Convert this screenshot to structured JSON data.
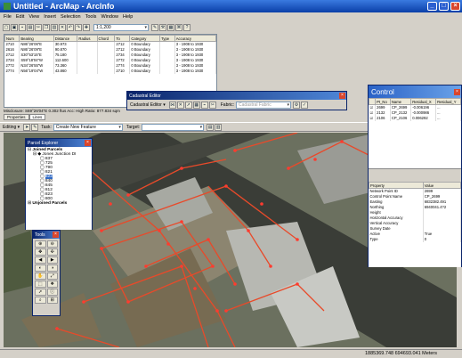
{
  "app": {
    "title": "Untitled - ArcMap - ArcInfo",
    "min": "_",
    "max": "□",
    "close": "×"
  },
  "menu": [
    "File",
    "Edit",
    "View",
    "Insert",
    "Selection",
    "Tools",
    "Window",
    "Help"
  ],
  "toolbar": {
    "scale": "1:1,200"
  },
  "table": {
    "headers": [
      "Num",
      "Bearing",
      "Distance",
      "Radius",
      "Chord",
      "To",
      "Category",
      "Type",
      "Accuracy"
    ],
    "rows": [
      [
        "2710",
        "N86°26'06\"E",
        "30.973",
        "",
        "",
        "2712",
        "0 Boundary",
        "",
        "3 - 1908 to 1930"
      ],
      [
        "2616",
        "N86°26'09\"E",
        "90.870",
        "",
        "",
        "2712",
        "0 Boundary",
        "",
        "3 - 1908 to 1930"
      ],
      [
        "2712",
        "S30°53'15\"E",
        "75.180",
        "",
        "",
        "2734",
        "0 Boundary",
        "",
        "3 - 1908 to 1930"
      ],
      [
        "2734",
        "S59°18'04\"W",
        "112.600",
        "",
        "",
        "2772",
        "0 Boundary",
        "",
        "3 - 1908 to 1930"
      ],
      [
        "2772",
        "N34°26'55\"W",
        "73.360",
        "",
        "",
        "2774",
        "0 Boundary",
        "",
        "3 - 1908 to 1930"
      ],
      [
        "2774",
        "N56°19'04\"W",
        "43.860",
        "",
        "",
        "2710",
        "0 Boundary",
        "",
        "3 - 1908 to 1930"
      ]
    ],
    "misclosure": "Misclosure: S69°26'04\"E 0.302 ftus  Acc: High  Ratio: 877.834 sqm",
    "tabs": [
      "Properties",
      "Lines"
    ]
  },
  "cadastral": {
    "title": "Cadastral Editor",
    "menu_label": "Cadastral Editor ▾",
    "fabric_label": "Fabric:",
    "fabric_value": "Cadastral Fabric"
  },
  "editor": {
    "menu": "Editing ▾",
    "task_label": "Task:",
    "task_value": "Create New Feature",
    "target_label": "Target:"
  },
  "control": {
    "title": "Control",
    "headers": [
      "",
      "Pt_No",
      "Name",
      "Residual_X",
      "Residual_Y"
    ],
    "rows": [
      [
        "2699",
        "CP_2699",
        "-0.006196",
        "..."
      ],
      [
        "2132",
        "CP_2132",
        "-0.000986",
        "..."
      ],
      [
        "2106",
        "CP_2106",
        "0.006292",
        "..."
      ]
    ],
    "prop_header": [
      "Property",
      "Value"
    ],
    "props": [
      [
        "Network Point ID",
        "2699"
      ],
      [
        "Control Point Name",
        "CP_2699"
      ],
      [
        "Easting",
        "6832382.491"
      ],
      [
        "Northing",
        "6940041.4?2"
      ],
      [
        "Height",
        ""
      ],
      [
        "Horizontal Accuracy",
        ""
      ],
      [
        "Vertical Accuracy",
        ""
      ],
      [
        "Survey Date",
        ""
      ],
      [
        "Active",
        "True"
      ],
      [
        "Type",
        "0"
      ]
    ]
  },
  "parcel_explorer": {
    "title": "Parcel Explorer",
    "root": "Joined Parcels",
    "group": "Jones Junction DI",
    "items": [
      "837",
      "725",
      "790",
      "821",
      "822",
      "840",
      "845",
      "812",
      "823",
      "800"
    ],
    "selected": "822",
    "unjoined": "Unjoined Parcels"
  },
  "tools_window": {
    "title": "Tools",
    "icons": [
      "⊕",
      "⊖",
      "✥",
      "✣",
      "◀",
      "▶",
      "◐",
      "◑",
      "✋",
      "⤢",
      "⬚",
      "❖",
      "➚",
      "ⓘ",
      "⌕",
      "⊞"
    ]
  },
  "status": {
    "coords": "1885369.748  694693.041 Meters"
  }
}
